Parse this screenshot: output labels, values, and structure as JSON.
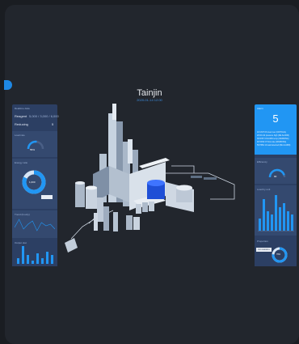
{
  "header": {
    "title": "Tainjin",
    "subtitle": "2020-01-14 12:00"
  },
  "left_panel": {
    "head_label": "Realtime data",
    "rows": [
      {
        "label": "Reagent",
        "value": "5,000 / 3,000 / 6,000"
      },
      {
        "label": "Reducing",
        "value": "5"
      }
    ],
    "gauge": {
      "label": "Load rate",
      "value_text": "55%",
      "fraction": 0.55
    },
    "donut": {
      "label": "Energy ratio",
      "value_text": "1,000",
      "fraction": 0.82
    },
    "line_section_label": "Trend (hourly)",
    "line_points": [
      4,
      9,
      3,
      6,
      8,
      2,
      7,
      5,
      6,
      3
    ],
    "bars_section_label": "Output stat",
    "bars": [
      3,
      10,
      5,
      2,
      6,
      3,
      7,
      5
    ]
  },
  "right_panel": {
    "head_label": "Alarm",
    "count": "5",
    "alerts": [
      "1# UNIT 03 level over  (CRITICAL)",
      "2# DC-02 pressure high  (RE ALARM)",
      "3# DIST COLUMN temp (WARNING)",
      "4# TANK 07 flow rate (WARNING)",
      "5# PIPE 12 leak detected (RE ALARM)"
    ],
    "gauge": {
      "label": "Efficiency",
      "value_text": "90",
      "fraction": 0.9
    },
    "bars_section_label": "Load by unit",
    "bars": [
      3,
      8,
      5,
      4,
      9,
      6,
      7,
      5,
      4
    ],
    "donut": {
      "label": "Proportion",
      "value_text": "76%",
      "fraction": 0.76
    },
    "tag_text": "Unit statistics"
  },
  "colors": {
    "accent": "#2196f3",
    "panel": "#2c3f63",
    "background": "#22262d"
  }
}
